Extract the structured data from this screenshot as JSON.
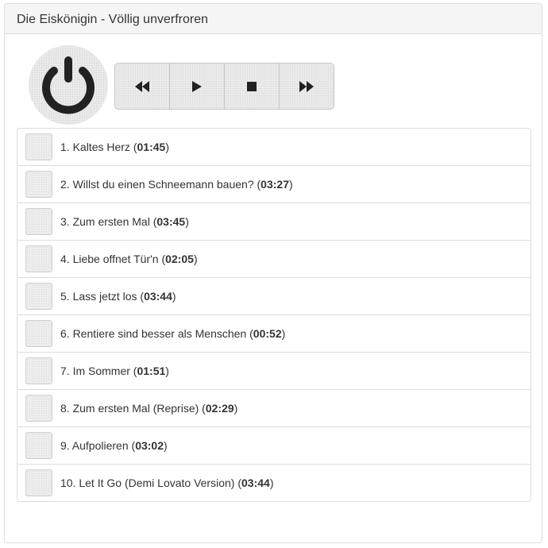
{
  "panel": {
    "title": "Die Eiskönigin - Völlig unverfroren"
  },
  "icons": {
    "power": "power-icon",
    "controls": [
      "rewind-icon",
      "play-icon",
      "stop-icon",
      "fast-forward-icon"
    ]
  },
  "colors": {
    "icon": "#222222",
    "button_bg": "#ececec",
    "border": "#dddddd"
  },
  "tracks": [
    {
      "title": "1. Kaltes Herz",
      "duration": "01:45"
    },
    {
      "title": "2. Willst du einen Schneemann bauen?",
      "duration": "03:27"
    },
    {
      "title": "3. Zum ersten Mal",
      "duration": "03:45"
    },
    {
      "title": "4. Liebe offnet Tür'n",
      "duration": "02:05"
    },
    {
      "title": "5. Lass jetzt los",
      "duration": "03:44"
    },
    {
      "title": "6. Rentiere sind besser als Menschen",
      "duration": "00:52"
    },
    {
      "title": "7. Im Sommer",
      "duration": "01:51"
    },
    {
      "title": "8. Zum ersten Mal (Reprise)",
      "duration": "02:29"
    },
    {
      "title": "9. Aufpolieren",
      "duration": "03:02"
    },
    {
      "title": "10. Let It Go (Demi Lovato Version)",
      "duration": "03:44"
    }
  ]
}
